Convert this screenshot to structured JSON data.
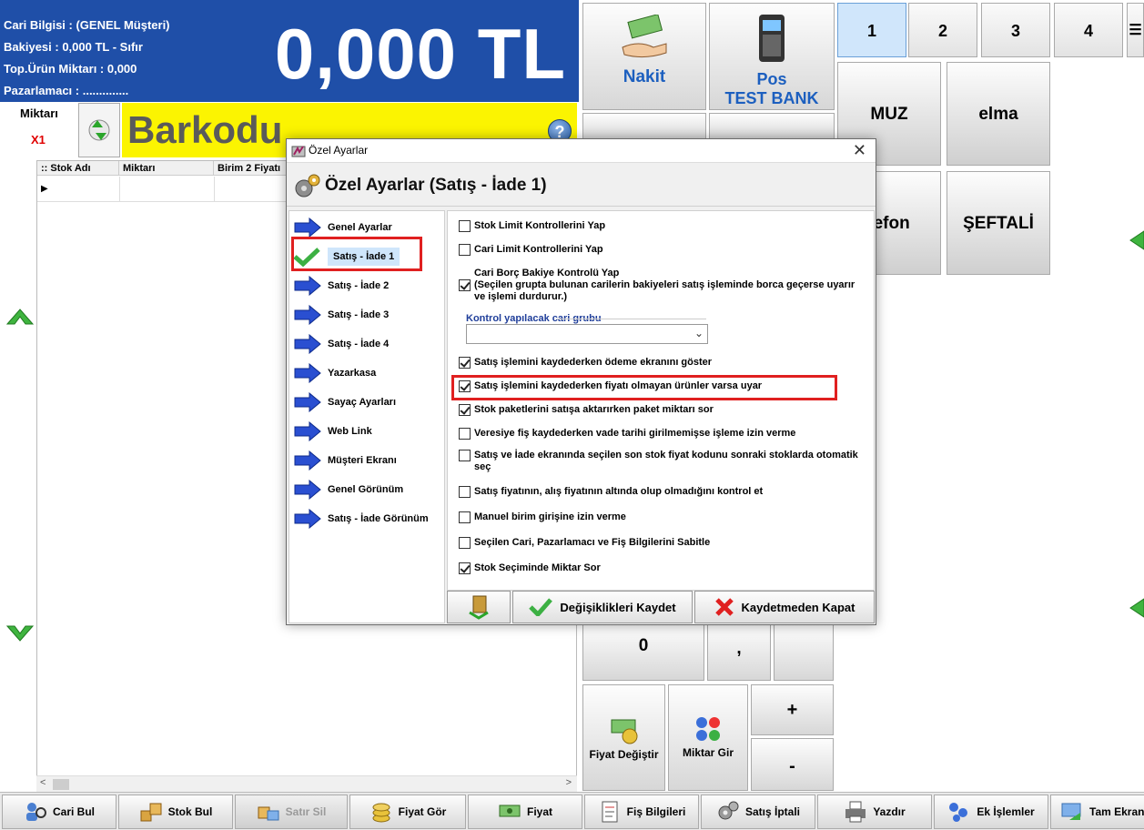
{
  "info": {
    "cari_bilgisi": "Cari Bilgisi : (GENEL Müşteri)",
    "bakiyesi": "Bakiyesi : 0,000 TL - Sıfır",
    "top_urun": "Top.Ürün Miktarı : 0,000",
    "pazarlamaci": "Pazarlamacı : ..............",
    "total": "0,000 TL"
  },
  "barcode": {
    "miktari_label": "Miktarı",
    "miktar_value": "X1",
    "barcode_placeholder": "Barkodu",
    "help": "?"
  },
  "grid": {
    "columns": [
      ":: Stok Adı",
      "Miktarı",
      "Birim 2 Fiyatı"
    ]
  },
  "payments": {
    "nakit": "Nakit",
    "pos_line1": "Pos",
    "pos_line2": "TEST BANK"
  },
  "tabs": [
    "1",
    "2",
    "3",
    "4"
  ],
  "products": [
    "MUZ",
    "elma",
    "lefon",
    "ŞEFTALİ"
  ],
  "keypad": {
    "zero": "0",
    "comma": ",",
    "plus": "+",
    "minus": "-",
    "fiyat_degistir": "Fiyat Değiştir",
    "miktar_gir": "Miktar Gir"
  },
  "toolbar": [
    {
      "label": "Cari Bul",
      "icon": "users-search-icon"
    },
    {
      "label": "Stok Bul",
      "icon": "boxes-icon"
    },
    {
      "label": "Satır Sil",
      "icon": "delete-row-icon"
    },
    {
      "label": "Fiyat Gör",
      "icon": "coins-icon"
    },
    {
      "label": "Fiyat",
      "icon": "money-icon"
    },
    {
      "label": "Fiş Bilgileri",
      "icon": "receipt-icon"
    },
    {
      "label": "Satış İptali",
      "icon": "gears-icon"
    },
    {
      "label": "Yazdır",
      "icon": "printer-icon"
    },
    {
      "label": "Ek İşlemler",
      "icon": "extra-ops-icon"
    },
    {
      "label": "Tam Ekran",
      "icon": "fullscreen-icon"
    }
  ],
  "dialog": {
    "window_title": "Özel Ayarlar",
    "header": "Özel Ayarlar (Satış - İade 1)",
    "nav": [
      "Genel Ayarlar",
      "Satış - İade 1",
      "Satış - İade 2",
      "Satış - İade 3",
      "Satış - İade 4",
      "Yazarkasa",
      "Sayaç Ayarları",
      "Web Link",
      "Müşteri Ekranı",
      "Genel Görünüm",
      "Satış - İade Görünüm"
    ],
    "options": [
      {
        "label": "Stok Limit Kontrollerini Yap",
        "checked": false
      },
      {
        "label": "Cari Limit Kontrollerini Yap",
        "checked": false
      },
      {
        "label": "Cari Borç Bakiye Kontrolü Yap",
        "label2": "(Seçilen grupta bulunan carilerin bakiyeleri satış işleminde borca geçerse uyarır ve işlemi durdurur.)",
        "checked": true
      },
      {
        "label": "Satış işlemini kaydederken ödeme ekranını göster",
        "checked": true
      },
      {
        "label": "Satış işlemini kaydederken fiyatı olmayan ürünler varsa uyar",
        "checked": true
      },
      {
        "label": "Stok paketlerini satışa aktarırken paket miktarı sor",
        "checked": true
      },
      {
        "label": "Veresiye fiş kaydederken vade tarihi girilmemişse işleme izin verme",
        "checked": false
      },
      {
        "label": "Satış ve İade ekranında seçilen son stok fiyat kodunu sonraki stoklarda otomatik seç",
        "checked": false
      },
      {
        "label": "Satış fiyatının, alış fiyatının altında olup olmadığını kontrol et",
        "checked": false
      },
      {
        "label": "Manuel birim girişine izin verme",
        "checked": false
      },
      {
        "label": "Seçilen Cari, Pazarlamacı ve Fiş Bilgilerini Sabitle",
        "checked": false
      },
      {
        "label": "Stok Seçiminde Miktar Sor",
        "checked": true
      }
    ],
    "group_label": "Kontrol yapılacak cari grubu",
    "group_value": "",
    "save": "Değişiklikleri Kaydet",
    "cancel": "Kaydetmeden Kapat"
  }
}
